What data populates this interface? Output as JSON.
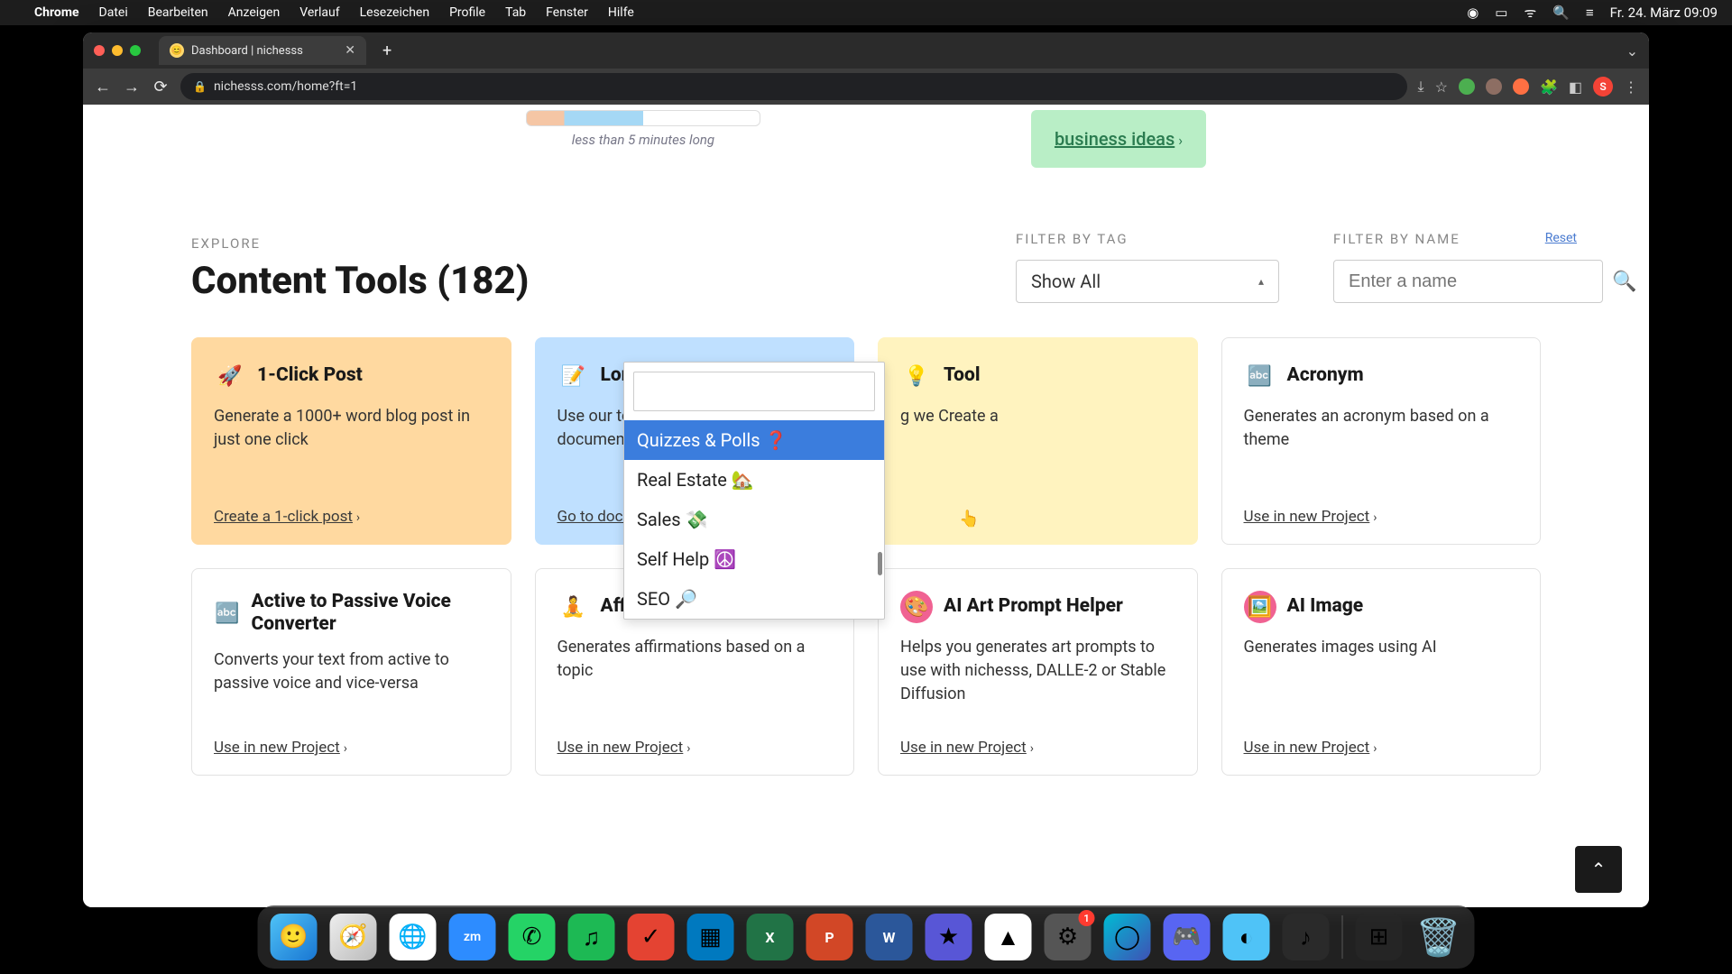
{
  "menubar": {
    "app": "Chrome",
    "items": [
      "Datei",
      "Bearbeiten",
      "Anzeigen",
      "Verlauf",
      "Lesezeichen",
      "Profile",
      "Tab",
      "Fenster",
      "Hilfe"
    ],
    "clock": "Fr. 24. März 09:09"
  },
  "browser": {
    "tab_title": "Dashboard | nichesss",
    "url": "nichesss.com/home?ft=1",
    "avatar_letter": "S"
  },
  "page": {
    "video_caption": "less than 5 minutes long",
    "biz_link": "business ideas",
    "explore_label": "EXPLORE",
    "title": "Content Tools (182)",
    "filter_tag_label": "FILTER BY TAG",
    "filter_tag_value": "Show All",
    "filter_name_label": "FILTER BY NAME",
    "filter_name_placeholder": "Enter a name",
    "reset": "Reset"
  },
  "dropdown": {
    "items": [
      {
        "label": "Quizzes & Polls ❓",
        "highlighted": true
      },
      {
        "label": "Real Estate 🏡",
        "highlighted": false
      },
      {
        "label": "Sales 💸",
        "highlighted": false
      },
      {
        "label": "Self Help ☮️",
        "highlighted": false
      },
      {
        "label": "SEO 🔎",
        "highlighted": false
      }
    ]
  },
  "cards_row1": [
    {
      "icon": "🚀",
      "title": "1-Click Post",
      "desc": "Generate a 1000+ word blog post in just one click",
      "link": "Create a 1-click post",
      "bg": "orange"
    },
    {
      "icon": "📝",
      "title": "Long Form",
      "desc": "Use our tools in a long form / document for",
      "link": "Go to documents",
      "bg": "blue"
    },
    {
      "icon": "💡",
      "title": "Tool",
      "desc": "g we Create a",
      "link": "",
      "bg": "yellow"
    },
    {
      "icon": "🔤",
      "title": "Acronym",
      "desc": "Generates an acronym based on a theme",
      "link": "Use in new Project",
      "bg": ""
    }
  ],
  "cards_row2": [
    {
      "icon": "🔤",
      "title": "Active to Passive Voice Converter",
      "desc": "Converts your text from active to passive voice and vice-versa",
      "link": "Use in new Project"
    },
    {
      "icon": "🧘",
      "title": "Affirmations",
      "desc": "Generates affirmations based on a topic",
      "link": "Use in new Project"
    },
    {
      "icon": "🎨",
      "title": "AI Art Prompt Helper",
      "desc": "Helps you generates art prompts to use with nichesss, DALLE-2 or Stable Diffusion",
      "link": "Use in new Project"
    },
    {
      "icon": "🖼️",
      "title": "AI Image",
      "desc": "Generates images using AI",
      "link": "Use in new Project"
    }
  ],
  "dock_badge": "1"
}
